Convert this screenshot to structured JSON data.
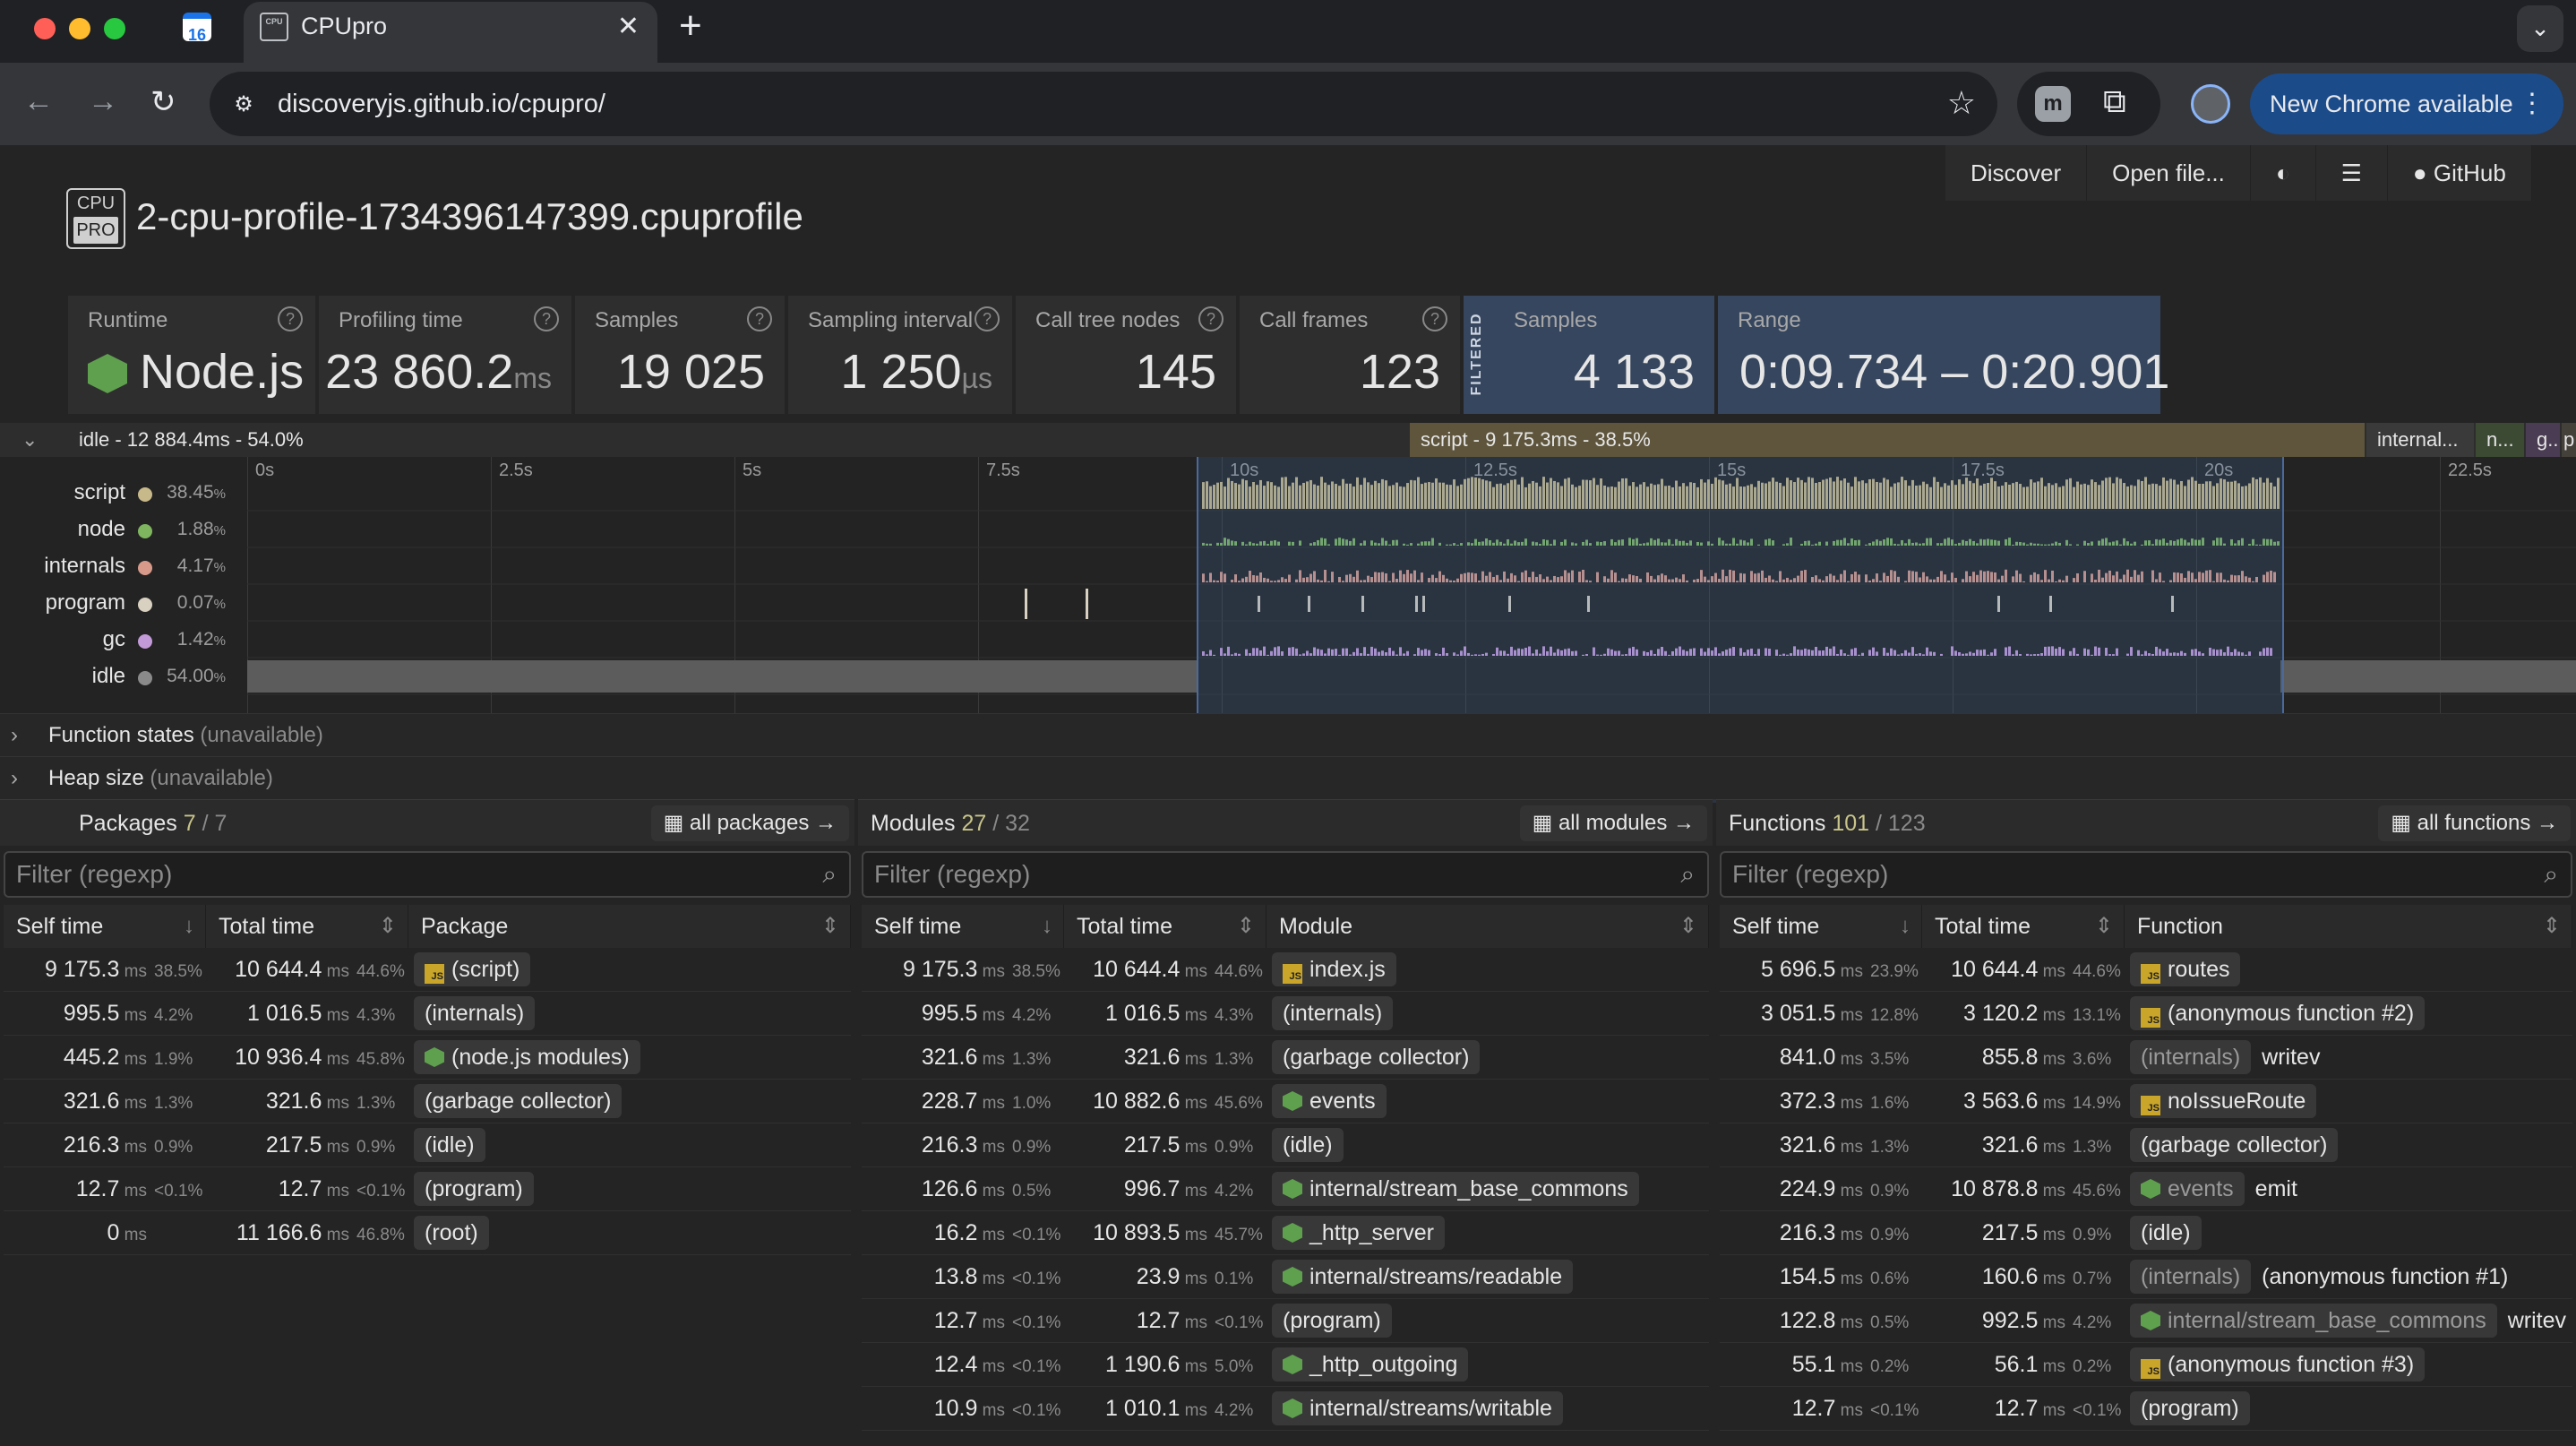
{
  "browser": {
    "tab_title": "CPUpro",
    "cal_badge": "16",
    "fav_text": "CPU",
    "url": "discoveryjs.github.io/cpupro/",
    "update_label": "New Chrome available",
    "ext_letter": "m"
  },
  "nav": [
    "Discover",
    "Open file...",
    "GitHub"
  ],
  "logo": {
    "top": "CPU",
    "bottom": "PRO"
  },
  "title": "2-cpu-profile-1734396147399.cpuprofile",
  "stats": {
    "runtime": {
      "label": "Runtime",
      "value": "Node.js"
    },
    "profiling_time": {
      "label": "Profiling time",
      "value": "23 860.2",
      "unit": "ms"
    },
    "samples": {
      "label": "Samples",
      "value": "19 025"
    },
    "sampling_interval": {
      "label": "Sampling interval",
      "value": "1 250",
      "unit": "µs"
    },
    "call_tree_nodes": {
      "label": "Call tree nodes",
      "value": "145"
    },
    "call_frames": {
      "label": "Call frames",
      "value": "123"
    },
    "filtered_tag": "FILTERED",
    "filtered_samples": {
      "label": "Samples",
      "value": "4 133"
    },
    "range": {
      "label": "Range",
      "value": "0:09.734 – 0:20.901"
    }
  },
  "category_strip": [
    {
      "label": "idle - 12 884.4ms - 54.0%",
      "color": "#2d2d2d"
    },
    {
      "label": "script - 9 175.3ms - 38.5%",
      "color": "#5e553c"
    },
    {
      "label": "internal...",
      "color": "#3a3a3a"
    },
    {
      "label": "n...",
      "color": "#3c4a34"
    },
    {
      "label": "g...",
      "color": "#4a3c52"
    },
    {
      "label": "p",
      "color": "#44403a"
    }
  ],
  "timeline": {
    "ticks": [
      "0s",
      "2.5s",
      "5s",
      "7.5s",
      "10s",
      "12.5s",
      "15s",
      "17.5s",
      "20s",
      "22.5s"
    ],
    "categories": [
      {
        "name": "script",
        "percent": "38.45",
        "color": "#c8b98a"
      },
      {
        "name": "node",
        "percent": "1.88",
        "color": "#7fb55f"
      },
      {
        "name": "internals",
        "percent": "4.17",
        "color": "#d79a8a"
      },
      {
        "name": "program",
        "percent": "0.07",
        "color": "#d8d0c0"
      },
      {
        "name": "gc",
        "percent": "1.42",
        "color": "#c39ad8"
      },
      {
        "name": "idle",
        "percent": "54.00",
        "color": "#8a8a8a"
      }
    ],
    "function_states": "Function states",
    "heap_size": "Heap size",
    "unavailable": "(unavailable)"
  },
  "packages": {
    "title": "Packages",
    "count": "7",
    "total": "/ 7",
    "all_label": "all packages →",
    "filter_placeholder": "Filter (regexp)",
    "columns": [
      "Self time",
      "Total time",
      "Package"
    ],
    "rows": [
      {
        "self": "9 175.3",
        "self_pct": "38.5%",
        "total": "10 644.4",
        "total_pct": "44.6%",
        "name": "(script)",
        "icon": "js"
      },
      {
        "self": "995.5",
        "self_pct": "4.2%",
        "total": "1 016.5",
        "total_pct": "4.3%",
        "name": "(internals)",
        "icon": ""
      },
      {
        "self": "445.2",
        "self_pct": "1.9%",
        "total": "10 936.4",
        "total_pct": "45.8%",
        "name": "(node.js modules)",
        "icon": "node"
      },
      {
        "self": "321.6",
        "self_pct": "1.3%",
        "total": "321.6",
        "total_pct": "1.3%",
        "name": "(garbage collector)",
        "icon": ""
      },
      {
        "self": "216.3",
        "self_pct": "0.9%",
        "total": "217.5",
        "total_pct": "0.9%",
        "name": "(idle)",
        "icon": ""
      },
      {
        "self": "12.7",
        "self_pct": "<0.1%",
        "total": "12.7",
        "total_pct": "<0.1%",
        "name": "(program)",
        "icon": ""
      },
      {
        "self": "0",
        "self_pct": "",
        "total": "11 166.6",
        "total_pct": "46.8%",
        "name": "(root)",
        "icon": ""
      }
    ]
  },
  "modules": {
    "title": "Modules",
    "count": "27",
    "total": "/ 32",
    "all_label": "all modules →",
    "filter_placeholder": "Filter (regexp)",
    "columns": [
      "Self time",
      "Total time",
      "Module"
    ],
    "rows": [
      {
        "self": "9 175.3",
        "self_pct": "38.5%",
        "total": "10 644.4",
        "total_pct": "44.6%",
        "name": "index.js",
        "icon": "js"
      },
      {
        "self": "995.5",
        "self_pct": "4.2%",
        "total": "1 016.5",
        "total_pct": "4.3%",
        "name": "(internals)",
        "icon": ""
      },
      {
        "self": "321.6",
        "self_pct": "1.3%",
        "total": "321.6",
        "total_pct": "1.3%",
        "name": "(garbage collector)",
        "icon": ""
      },
      {
        "self": "228.7",
        "self_pct": "1.0%",
        "total": "10 882.6",
        "total_pct": "45.6%",
        "name": "events",
        "icon": "node"
      },
      {
        "self": "216.3",
        "self_pct": "0.9%",
        "total": "217.5",
        "total_pct": "0.9%",
        "name": "(idle)",
        "icon": ""
      },
      {
        "self": "126.6",
        "self_pct": "0.5%",
        "total": "996.7",
        "total_pct": "4.2%",
        "name": "internal/stream_base_commons",
        "icon": "node"
      },
      {
        "self": "16.2",
        "self_pct": "<0.1%",
        "total": "10 893.5",
        "total_pct": "45.7%",
        "name": "_http_server",
        "icon": "node"
      },
      {
        "self": "13.8",
        "self_pct": "<0.1%",
        "total": "23.9",
        "total_pct": "0.1%",
        "name": "internal/streams/readable",
        "icon": "node"
      },
      {
        "self": "12.7",
        "self_pct": "<0.1%",
        "total": "12.7",
        "total_pct": "<0.1%",
        "name": "(program)",
        "icon": ""
      },
      {
        "self": "12.4",
        "self_pct": "<0.1%",
        "total": "1 190.6",
        "total_pct": "5.0%",
        "name": "_http_outgoing",
        "icon": "node"
      },
      {
        "self": "10.9",
        "self_pct": "<0.1%",
        "total": "1 010.1",
        "total_pct": "4.2%",
        "name": "internal/streams/writable",
        "icon": "node"
      }
    ]
  },
  "functions": {
    "title": "Functions",
    "count": "101",
    "total": "/ 123",
    "all_label": "all functions →",
    "filter_placeholder": "Filter (regexp)",
    "columns": [
      "Self time",
      "Total time",
      "Function"
    ],
    "rows": [
      {
        "self": "5 696.5",
        "self_pct": "23.9%",
        "total": "10 644.4",
        "total_pct": "44.6%",
        "module": "",
        "name": "routes",
        "icon": "js"
      },
      {
        "self": "3 051.5",
        "self_pct": "12.8%",
        "total": "3 120.2",
        "total_pct": "13.1%",
        "module": "",
        "name": "(anonymous function #2)",
        "icon": "js"
      },
      {
        "self": "841.0",
        "self_pct": "3.5%",
        "total": "855.8",
        "total_pct": "3.6%",
        "module": "(internals)",
        "name": "writev",
        "icon": ""
      },
      {
        "self": "372.3",
        "self_pct": "1.6%",
        "total": "3 563.6",
        "total_pct": "14.9%",
        "module": "",
        "name": "noIssueRoute",
        "icon": "js"
      },
      {
        "self": "321.6",
        "self_pct": "1.3%",
        "total": "321.6",
        "total_pct": "1.3%",
        "module": "",
        "name": "(garbage collector)",
        "icon": ""
      },
      {
        "self": "224.9",
        "self_pct": "0.9%",
        "total": "10 878.8",
        "total_pct": "45.6%",
        "module": "events",
        "name": "emit",
        "icon": "node"
      },
      {
        "self": "216.3",
        "self_pct": "0.9%",
        "total": "217.5",
        "total_pct": "0.9%",
        "module": "",
        "name": "(idle)",
        "icon": ""
      },
      {
        "self": "154.5",
        "self_pct": "0.6%",
        "total": "160.6",
        "total_pct": "0.7%",
        "module": "(internals)",
        "name": "(anonymous function #1)",
        "icon": ""
      },
      {
        "self": "122.8",
        "self_pct": "0.5%",
        "total": "992.5",
        "total_pct": "4.2%",
        "module": "internal/stream_base_commons",
        "name": "writevGe",
        "icon": "node"
      },
      {
        "self": "55.1",
        "self_pct": "0.2%",
        "total": "56.1",
        "total_pct": "0.2%",
        "module": "",
        "name": "(anonymous function #3)",
        "icon": "js"
      },
      {
        "self": "12.7",
        "self_pct": "<0.1%",
        "total": "12.7",
        "total_pct": "<0.1%",
        "module": "",
        "name": "(program)",
        "icon": ""
      }
    ]
  },
  "units": {
    "ms": "ms"
  }
}
